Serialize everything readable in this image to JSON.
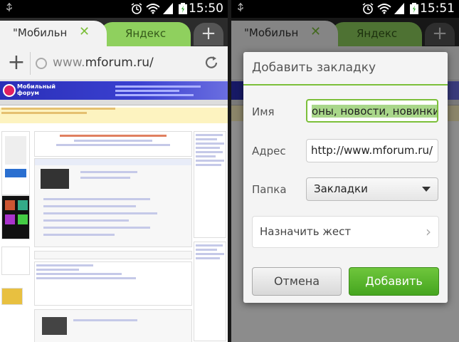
{
  "left": {
    "status": {
      "time": "15:50"
    },
    "tabs": {
      "active_title": "\"Мобильн",
      "inactive_title": "Яндекс",
      "close_glyph": "✕",
      "new_tab_glyph": "+"
    },
    "urlbar": {
      "prefix": "www.",
      "domain": "mforum.ru/"
    },
    "site": {
      "logo_line1": "Мобильный",
      "logo_line2": "форум"
    }
  },
  "right": {
    "status": {
      "time": "15:51"
    },
    "tabs": {
      "active_title": "\"Мобильн",
      "inactive_title": "Яндекс",
      "close_glyph": "✕",
      "new_tab_glyph": "+"
    },
    "dialog": {
      "title": "Добавить закладку",
      "name_label": "Имя",
      "name_value": "оны, новости, новинки",
      "address_label": "Адрес",
      "address_value": "http://www.mforum.ru/",
      "folder_label": "Папка",
      "folder_value": "Закладки",
      "gesture_label": "Назначить жест",
      "gesture_chevron": "›",
      "cancel_label": "Отмена",
      "add_label": "Добавить"
    }
  },
  "colors": {
    "accent_green": "#7cbf3a",
    "add_button": "#45a51f",
    "site_header": "#2a2fb8"
  }
}
